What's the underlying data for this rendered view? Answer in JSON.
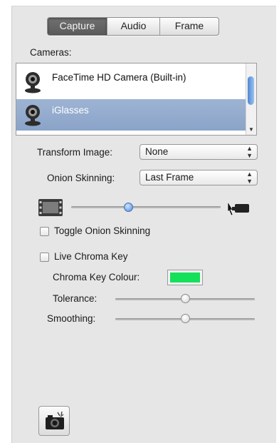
{
  "tabs": [
    {
      "label": "Capture",
      "active": true
    },
    {
      "label": "Audio",
      "active": false
    },
    {
      "label": "Frame",
      "active": false
    }
  ],
  "cameras": {
    "label": "Cameras:",
    "items": [
      {
        "name": "FaceTime HD Camera (Built-in)",
        "selected": false,
        "icon": "webcam-icon"
      },
      {
        "name": "iGlasses",
        "selected": true,
        "icon": "webcam-icon"
      }
    ]
  },
  "transform": {
    "label": "Transform Image:",
    "value": "None"
  },
  "onion": {
    "label": "Onion Skinning:",
    "value": "Last Frame"
  },
  "onion_slider": {
    "value": 0.3,
    "left_icon": "film-frame-icon",
    "right_icon": "camera-icon"
  },
  "toggle_onion": {
    "label": "Toggle Onion Skinning",
    "checked": false
  },
  "chroma": {
    "label": "Live Chroma Key",
    "checked": false,
    "colour_label": "Chroma Key Colour:",
    "colour": "#14e05a",
    "tolerance_label": "Tolerance:",
    "tolerance": 0.5,
    "smoothing_label": "Smoothing:",
    "smoothing": 0.5
  },
  "snapshot_button": {
    "icon": "camera-snapshot-icon"
  }
}
